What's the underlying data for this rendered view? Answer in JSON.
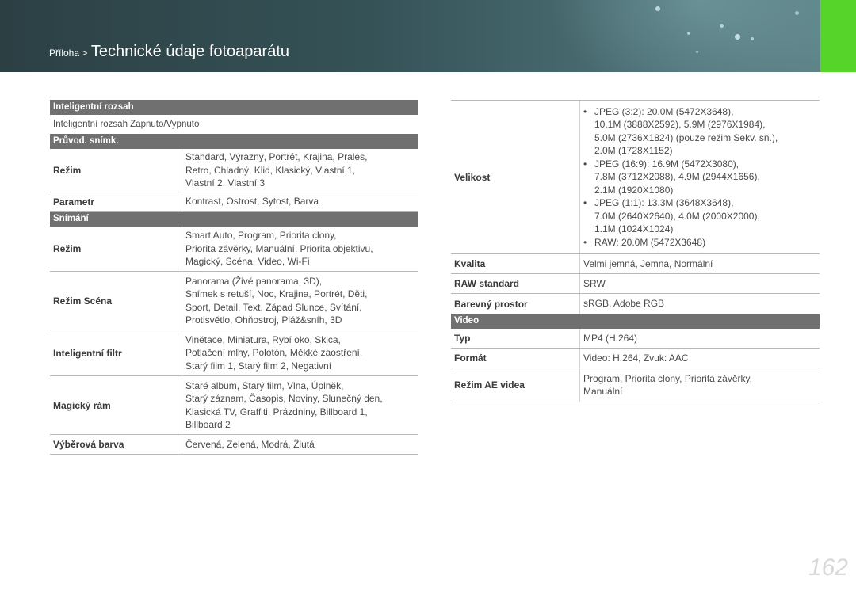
{
  "header": {
    "section": "Příloha >",
    "title": "Technické údaje fotoaparátu"
  },
  "left": {
    "intel_range": {
      "header": "Inteligentní rozsah",
      "text": "Inteligentní rozsah Zapnuto/Vypnuto"
    },
    "pruvod": {
      "header": "Průvod. snímk.",
      "rows": [
        {
          "label": "Režim",
          "lines": [
            "Standard, Výrazný, Portrét, Krajina, Prales,",
            "Retro, Chladný, Klid, Klasický, Vlastní 1,",
            "Vlastní 2, Vlastní 3"
          ]
        },
        {
          "label": "Parametr",
          "lines": [
            "Kontrast, Ostrost, Sytost, Barva"
          ]
        }
      ]
    },
    "snimani": {
      "header": "Snímání",
      "rows": [
        {
          "label": "Režim",
          "lines": [
            "Smart Auto, Program, Priorita clony,",
            "Priorita závěrky, Manuální, Priorita objektivu,",
            "Magický, Scéna, Video, Wi-Fi"
          ]
        },
        {
          "label": "Režim Scéna",
          "lines": [
            "Panorama (Živé panorama, 3D),",
            "Snímek s retuší, Noc, Krajina, Portrét, Děti,",
            "Sport, Detail, Text, Západ Slunce, Svítání,",
            "Protisvětlo, Ohňostroj, Pláž&sníh, 3D"
          ]
        },
        {
          "label": "Inteligentní filtr",
          "lines": [
            "Vinětace, Miniatura, Rybí oko, Skica,",
            "Potlačení mlhy, Polotón, Měkké zaostření,",
            "Starý film 1, Starý film 2, Negativní"
          ]
        },
        {
          "label": "Magický rám",
          "lines": [
            "Staré album, Starý film, Vlna, Úplněk,",
            "Starý záznam, Časopis, Noviny, Slunečný den,",
            "Klasická TV, Graffiti, Prázdniny, Billboard 1,",
            "Billboard 2"
          ]
        },
        {
          "label": "Výběrová barva",
          "lines": [
            "Červená, Zelená, Modrá, Žlutá"
          ]
        }
      ]
    }
  },
  "right": {
    "velikost": {
      "label": "Velikost",
      "bullets": [
        [
          "JPEG (3:2): 20.0M (5472X3648),",
          "10.1M (3888X2592), 5.9M (2976X1984),",
          "5.0M (2736X1824) (pouze režim Sekv. sn.),",
          "2.0M (1728X1152)"
        ],
        [
          "JPEG (16:9): 16.9M (5472X3080),",
          "7.8M (3712X2088), 4.9M (2944X1656),",
          "2.1M (1920X1080)"
        ],
        [
          "JPEG (1:1): 13.3M (3648X3648),",
          "7.0M (2640X2640), 4.0M (2000X2000),",
          "1.1M (1024X1024)"
        ],
        [
          "RAW: 20.0M (5472X3648)"
        ]
      ],
      "bullet_mark": "•"
    },
    "rows": [
      {
        "label": "Kvalita",
        "lines": [
          "Velmi jemná, Jemná, Normální"
        ]
      },
      {
        "label": "RAW standard",
        "lines": [
          "SRW"
        ]
      },
      {
        "label": "Barevný prostor",
        "lines": [
          "sRGB, Adobe RGB"
        ]
      }
    ],
    "video": {
      "header": "Video",
      "rows": [
        {
          "label": "Typ",
          "lines": [
            "MP4 (H.264)"
          ]
        },
        {
          "label": "Formát",
          "lines": [
            "Video: H.264, Zvuk: AAC"
          ]
        },
        {
          "label": "Režim AE videa",
          "lines": [
            "Program, Priorita clony, Priorita závěrky,",
            "Manuální"
          ]
        }
      ]
    }
  },
  "page_number": "162",
  "colors": {
    "accent_green": "#56d42a",
    "section_header": "#707070",
    "banner": "#355257"
  }
}
